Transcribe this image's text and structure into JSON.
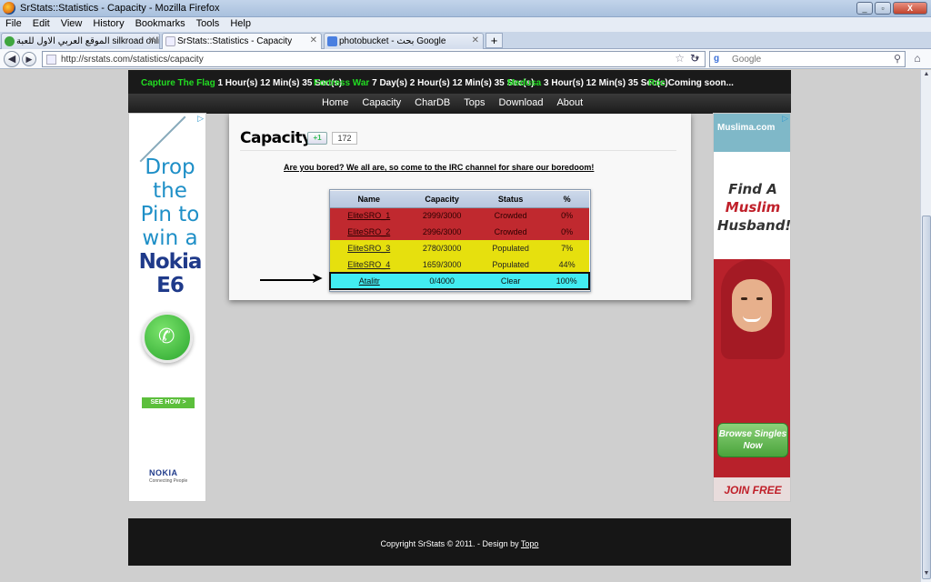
{
  "window": {
    "title": "SrStats::Statistics - Capacity - Mozilla Firefox",
    "buttons": [
      "_",
      "▫",
      "X"
    ]
  },
  "menu": [
    "File",
    "Edit",
    "View",
    "History",
    "Bookmarks",
    "Tools",
    "Help"
  ],
  "tabs": [
    {
      "label": "الموقع العربي الاول للعبة silkroad online",
      "active": false
    },
    {
      "label": "SrStats::Statistics - Capacity",
      "active": true
    },
    {
      "label": "photobucket - بحث Google",
      "active": false
    }
  ],
  "nav": {
    "url": "http://srstats.com/statistics/capacity",
    "search_placeholder": "Google"
  },
  "timers": [
    {
      "event": "Capture The Flag",
      "time": "1 Hour(s) 12 Min(s) 35 Sec(s)"
    },
    {
      "event": "Fortress War",
      "time": "7 Day(s) 2 Hour(s) 12 Min(s) 35 Sec(s)"
    },
    {
      "event": "Medusa",
      "time": "3 Hour(s) 12 Min(s) 35 Sec(s)"
    },
    {
      "event": "Roc",
      "time": "Coming soon..."
    }
  ],
  "site_nav": [
    "Home",
    "Capacity",
    "CharDB",
    "Tops",
    "Download",
    "About"
  ],
  "page": {
    "title": "Capacity",
    "plusone_label": "+1",
    "plusone_count": "172",
    "irc_notice": "Are you bored? We all are, so come to the IRC channel for share our boredoom!"
  },
  "table": {
    "headers": [
      "Name",
      "Capacity",
      "Status",
      "%"
    ],
    "rows": [
      {
        "name": "EliteSRO_1",
        "capacity": "2999/3000",
        "status": "Crowded",
        "pct": "0%",
        "kind": "crowded"
      },
      {
        "name": "EliteSRO_2",
        "capacity": "2996/3000",
        "status": "Crowded",
        "pct": "0%",
        "kind": "crowded"
      },
      {
        "name": "EliteSRO_3",
        "capacity": "2780/3000",
        "status": "Populated",
        "pct": "7%",
        "kind": "populated"
      },
      {
        "name": "EliteSRO_4",
        "capacity": "1659/3000",
        "status": "Populated",
        "pct": "44%",
        "kind": "populated"
      },
      {
        "name": "Atalitr",
        "capacity": "0/4000",
        "status": "Clear",
        "pct": "100%",
        "kind": "clear"
      }
    ]
  },
  "ad_left": {
    "headline": "Drop the Pin to win a",
    "brand": "Nokia E6",
    "cta": "SEE HOW >",
    "logo": "NOKIA",
    "logo_sub": "Connecting People"
  },
  "ad_right": {
    "logo": "Muslima.com",
    "headline_1": "Find A",
    "headline_accent": "Muslim",
    "headline_2": "Husband!",
    "cta": "Browse Singles Now",
    "join": "JOIN FREE"
  },
  "footer": {
    "copyright": "Copyright SrStats © 2011. - Design by ",
    "designer": "Topo"
  },
  "colors": {
    "crowded": "#c0292f",
    "populated": "#e6e00e",
    "clear": "#42ecf1",
    "timer_event": "#22dd22"
  }
}
